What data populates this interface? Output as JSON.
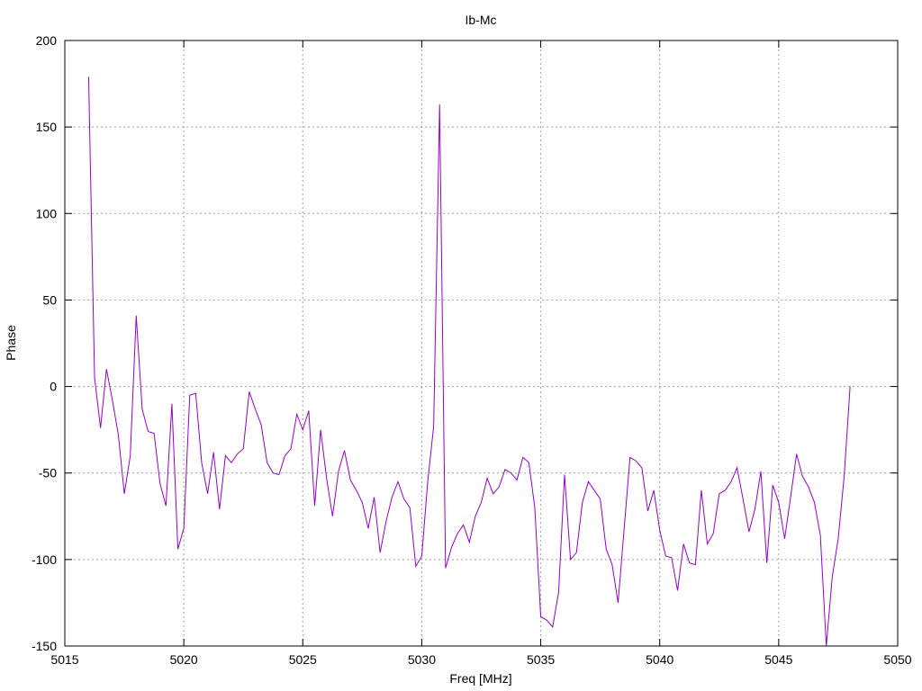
{
  "chart_data": {
    "type": "line",
    "title": "Ib-Mc",
    "xlabel": "Freq [MHz]",
    "ylabel": "Phase",
    "xlim": [
      5015,
      5050
    ],
    "ylim": [
      -150,
      200
    ],
    "xticks": [
      5015,
      5020,
      5025,
      5030,
      5035,
      5040,
      5045,
      5050
    ],
    "yticks": [
      -150,
      -100,
      -50,
      0,
      50,
      100,
      150,
      200
    ],
    "grid": true,
    "line_color": "#9400d3",
    "series": [
      {
        "x": [
          5016.0,
          5016.25,
          5016.5,
          5016.75,
          5017.0,
          5017.25,
          5017.5,
          5017.75,
          5018.0,
          5018.25,
          5018.5,
          5018.75,
          5019.0,
          5019.25,
          5019.5,
          5019.75,
          5020.0,
          5020.25,
          5020.5,
          5020.75,
          5021.0,
          5021.25,
          5021.5,
          5021.75,
          5022.0,
          5022.25,
          5022.5,
          5022.75,
          5023.0,
          5023.25,
          5023.5,
          5023.75,
          5024.0,
          5024.25,
          5024.5,
          5024.75,
          5025.0,
          5025.25,
          5025.5,
          5025.75,
          5026.0,
          5026.25,
          5026.5,
          5026.75,
          5027.0,
          5027.25,
          5027.5,
          5027.75,
          5028.0,
          5028.25,
          5028.5,
          5028.75,
          5029.0,
          5029.25,
          5029.5,
          5029.75,
          5030.0,
          5030.25,
          5030.5,
          5030.75,
          5031.0,
          5031.25,
          5031.5,
          5031.75,
          5032.0,
          5032.25,
          5032.5,
          5032.75,
          5033.0,
          5033.25,
          5033.5,
          5033.75,
          5034.0,
          5034.25,
          5034.5,
          5034.75,
          5035.0,
          5035.25,
          5035.5,
          5035.75,
          5036.0,
          5036.25,
          5036.5,
          5036.75,
          5037.0,
          5037.25,
          5037.5,
          5037.75,
          5038.0,
          5038.25,
          5038.5,
          5038.75,
          5039.0,
          5039.25,
          5039.5,
          5039.75,
          5040.0,
          5040.25,
          5040.5,
          5040.75,
          5041.0,
          5041.25,
          5041.5,
          5041.75,
          5042.0,
          5042.25,
          5042.5,
          5042.75,
          5043.0,
          5043.25,
          5043.5,
          5043.75,
          5044.0,
          5044.25,
          5044.5,
          5044.75,
          5045.0,
          5045.25,
          5045.5,
          5045.75,
          5046.0,
          5046.25,
          5046.5,
          5046.75,
          5047.0,
          5047.25,
          5047.5,
          5047.75,
          5048.0
        ],
        "y": [
          179,
          5,
          -24,
          10,
          -8,
          -28,
          -62,
          -40,
          41,
          -13,
          -26,
          -27,
          -56,
          -69,
          -10,
          -94,
          -82,
          -5,
          -4,
          -44,
          -62,
          -38,
          -71,
          -40,
          -44,
          -39,
          -36,
          -3,
          -13,
          -22,
          -44,
          -50,
          -51,
          -40,
          -36,
          -16,
          -25,
          -14,
          -69,
          -25,
          -53,
          -75,
          -49,
          -37,
          -54,
          -60,
          -67,
          -82,
          -64,
          -96,
          -78,
          -64,
          -55,
          -65,
          -70,
          -104,
          -98,
          -55,
          -23,
          163,
          -105,
          -93,
          -85,
          -80,
          -90,
          -75,
          -67,
          -53,
          -62,
          -58,
          -48,
          -50,
          -54,
          -41,
          -44,
          -70,
          -133,
          -135,
          -139,
          -119,
          -51,
          -100,
          -96,
          -67,
          -55,
          -60,
          -65,
          -94,
          -103,
          -125,
          -83,
          -41,
          -43,
          -47,
          -72,
          -60,
          -83,
          -98,
          -99,
          -118,
          -91,
          -102,
          -103,
          -60,
          -91,
          -85,
          -62,
          -60,
          -55,
          -47,
          -65,
          -84,
          -71,
          -49,
          -102,
          -57,
          -67,
          -88,
          -64,
          -39,
          -52,
          -58,
          -67,
          -86,
          -150,
          -110,
          -88,
          -52,
          0
        ]
      }
    ]
  }
}
